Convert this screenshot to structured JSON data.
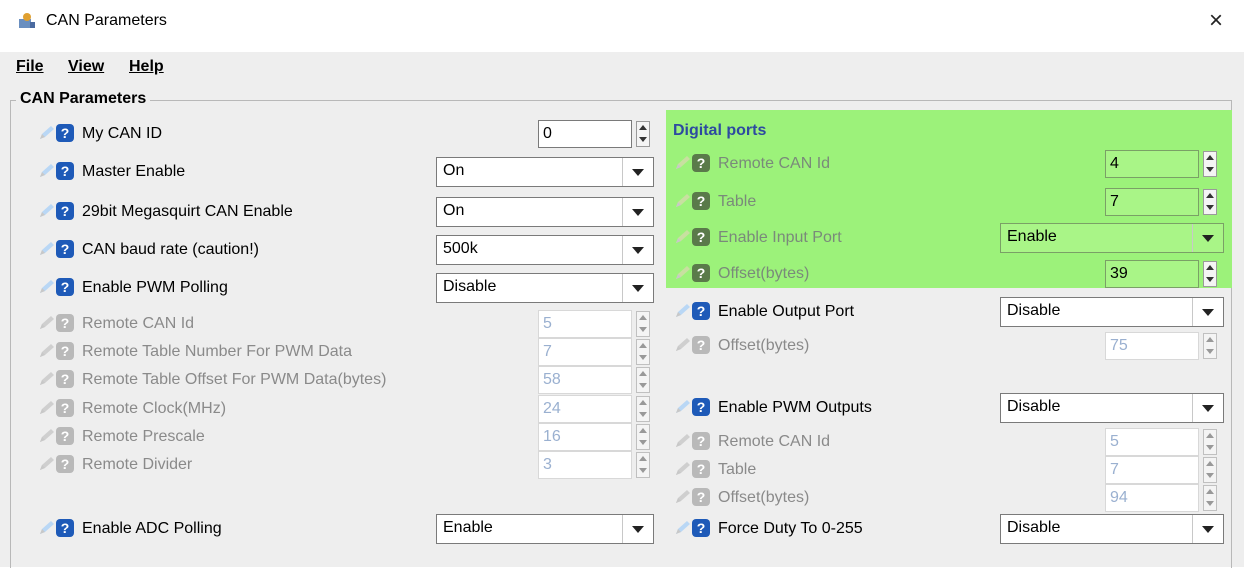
{
  "window": {
    "title": "CAN Parameters",
    "close": "×"
  },
  "menu": [
    "File",
    "View",
    "Help"
  ],
  "group_title": "CAN Parameters",
  "left": [
    {
      "label": "My CAN ID",
      "type": "spin",
      "value": "0",
      "enabled": true
    },
    {
      "label": "Master Enable",
      "type": "combo",
      "value": "On",
      "enabled": true
    },
    {
      "label": "29bit Megasquirt CAN Enable",
      "type": "combo",
      "value": "On",
      "enabled": true
    },
    {
      "label": "CAN baud rate (caution!)",
      "type": "combo",
      "value": "500k",
      "enabled": true
    },
    {
      "label": "Enable PWM Polling",
      "type": "combo",
      "value": "Disable",
      "enabled": true
    },
    {
      "label": "Remote CAN Id",
      "type": "spin",
      "value": "5",
      "enabled": false
    },
    {
      "label": "Remote Table Number For PWM Data",
      "type": "spin",
      "value": "7",
      "enabled": false
    },
    {
      "label": "Remote Table Offset For PWM Data(bytes)",
      "type": "spin",
      "value": "58",
      "enabled": false
    },
    {
      "label": "Remote Clock(MHz)",
      "type": "spin",
      "value": "24",
      "enabled": false
    },
    {
      "label": "Remote Prescale",
      "type": "spin",
      "value": "16",
      "enabled": false
    },
    {
      "label": "Remote Divider",
      "type": "spin",
      "value": "3",
      "enabled": false
    },
    {
      "label": "Enable ADC Polling",
      "type": "combo",
      "value": "Enable",
      "enabled": true
    }
  ],
  "digital_ports": {
    "title": "Digital ports",
    "highlight_color": "#9cf27a",
    "rows": [
      {
        "label": "Remote CAN Id",
        "type": "spin",
        "value": "4"
      },
      {
        "label": "Table",
        "type": "spin",
        "value": "7"
      },
      {
        "label": "Enable Input Port",
        "type": "combo",
        "value": "Enable"
      },
      {
        "label": "Offset(bytes)",
        "type": "spin",
        "value": "39"
      }
    ]
  },
  "right": [
    {
      "label": "Enable Output Port",
      "type": "combo",
      "value": "Disable",
      "enabled": true
    },
    {
      "label": "Offset(bytes)",
      "type": "spin",
      "value": "75",
      "enabled": false
    },
    {
      "label": "Enable PWM Outputs",
      "type": "combo",
      "value": "Disable",
      "enabled": true
    },
    {
      "label": "Remote CAN Id",
      "type": "spin",
      "value": "5",
      "enabled": false
    },
    {
      "label": "Table",
      "type": "spin",
      "value": "7",
      "enabled": false
    },
    {
      "label": "Offset(bytes)",
      "type": "spin",
      "value": "94",
      "enabled": false
    },
    {
      "label": "Force Duty To 0-255",
      "type": "combo",
      "value": "Disable",
      "enabled": true
    }
  ]
}
